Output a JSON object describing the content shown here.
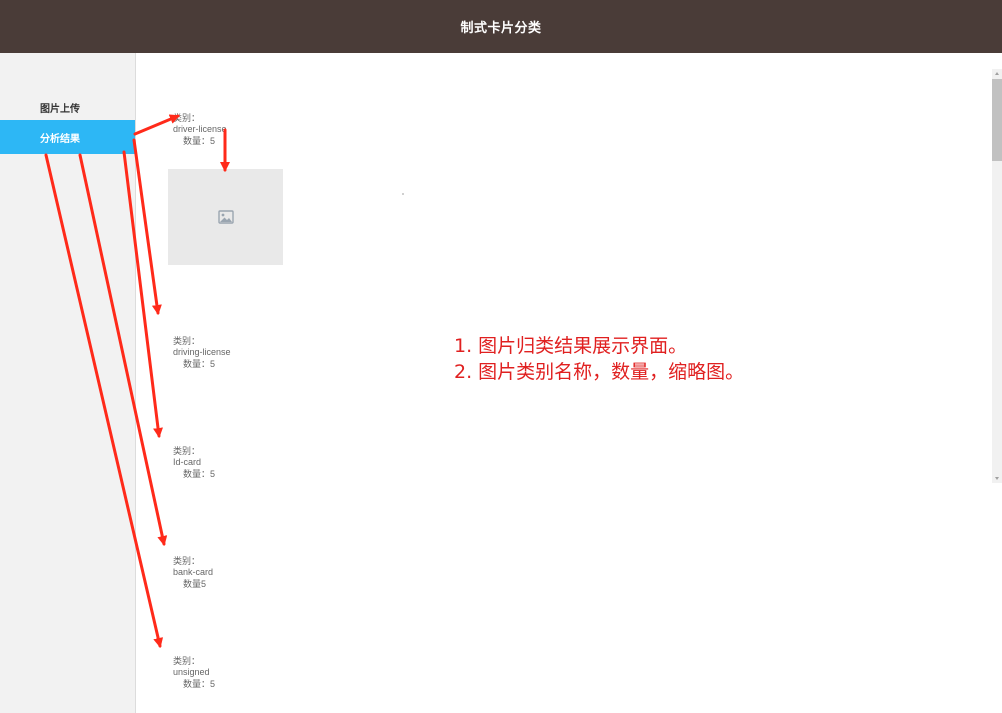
{
  "header": {
    "title": "制式卡片分类"
  },
  "sidebar": {
    "items": [
      {
        "label": "图片上传",
        "active": false
      },
      {
        "label": "分析结果",
        "active": true
      }
    ]
  },
  "results": {
    "categories": [
      {
        "label_prefix": "类别：",
        "name": "driver-license",
        "count_label": "数量：5"
      },
      {
        "label_prefix": "类别：",
        "name": "driving-license",
        "count_label": "数量：5"
      },
      {
        "label_prefix": "类别：",
        "name": "Id-card",
        "count_label": "数量：5"
      },
      {
        "label_prefix": "类别：",
        "name": "bank-card",
        "count_label": "数量5"
      },
      {
        "label_prefix": "类别：",
        "name": "unsigned",
        "count_label": "数量：5"
      }
    ],
    "thumbnail_icon": "image-placeholder-icon"
  },
  "annotation": {
    "lines": [
      "1. 图片归类结果展示界面。",
      "2. 图片类别名称，数量，缩略图。"
    ],
    "color": "#e02020"
  },
  "colors": {
    "header_bg": "#4a3c38",
    "active_nav": "#2db7f5",
    "arrow": "#ff2a1a"
  }
}
